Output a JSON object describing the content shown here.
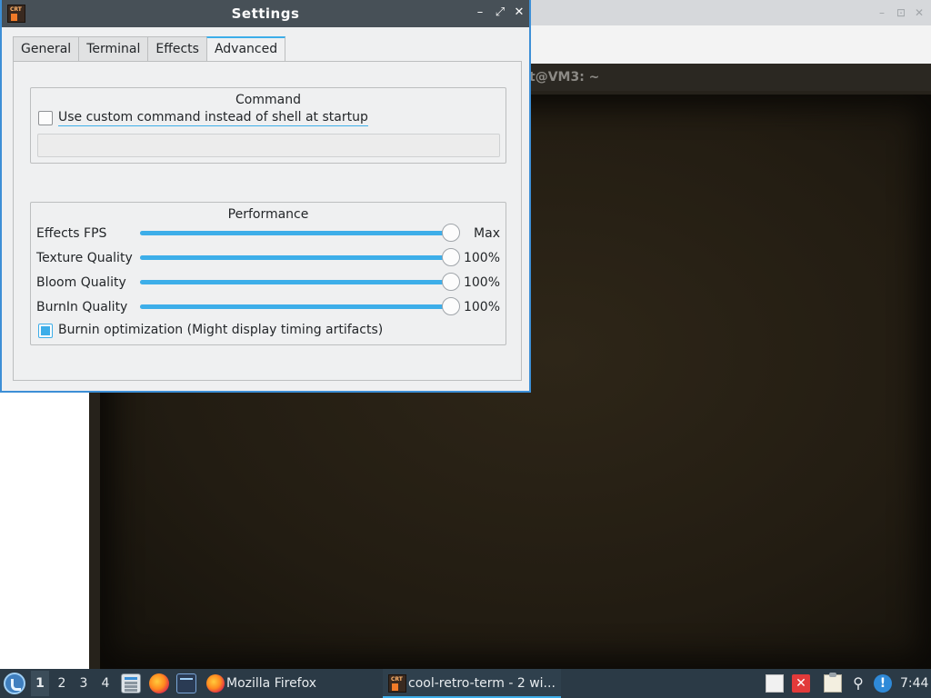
{
  "background": {
    "terminal_title": "t@VM3: ~",
    "controls": {
      "minimize": "–",
      "maximize": "⊡",
      "close": "✕"
    }
  },
  "dialog": {
    "title": "Settings",
    "icon_text": "CRT",
    "controls": {
      "minimize": "–",
      "maximize": "⤢",
      "close": "✕"
    },
    "tabs": [
      {
        "label": "General",
        "active": false
      },
      {
        "label": "Terminal",
        "active": false
      },
      {
        "label": "Effects",
        "active": false
      },
      {
        "label": "Advanced",
        "active": true
      }
    ],
    "command_group": {
      "title": "Command",
      "checkbox_label": "Use custom command instead of shell at startup",
      "checked": false,
      "command_value": ""
    },
    "performance_group": {
      "title": "Performance",
      "rows": [
        {
          "label": "Effects FPS",
          "value_text": "Max",
          "fraction": 1.0
        },
        {
          "label": "Texture Quality",
          "value_text": "100%",
          "fraction": 1.0
        },
        {
          "label": "Bloom Quality",
          "value_text": "100%",
          "fraction": 1.0
        },
        {
          "label": "BurnIn Quality",
          "value_text": "100%",
          "fraction": 1.0
        }
      ],
      "burnin_opt_label": "Burnin optimization (Might display timing artifacts)",
      "burnin_opt_checked": true
    }
  },
  "taskbar": {
    "desktops": [
      "1",
      "2",
      "3",
      "4"
    ],
    "active_desktop": "1",
    "launchers": [
      "file-manager-icon",
      "firefox-icon",
      "terminal-icon"
    ],
    "tasks": [
      {
        "label": "Mozilla Firefox",
        "icon": "firefox-icon"
      },
      {
        "label": "cool-retro-term - 2 wi...",
        "icon": "cool-retro-term-icon"
      }
    ],
    "tray": {
      "x_glyph": "✕",
      "plug_glyph": "⚲",
      "alert_glyph": "!"
    },
    "clock": "7:44"
  },
  "colors": {
    "accent": "#3daee9",
    "titlebar": "#475057",
    "window_border": "#3d8fd6",
    "taskbar": "#2b3a46"
  }
}
